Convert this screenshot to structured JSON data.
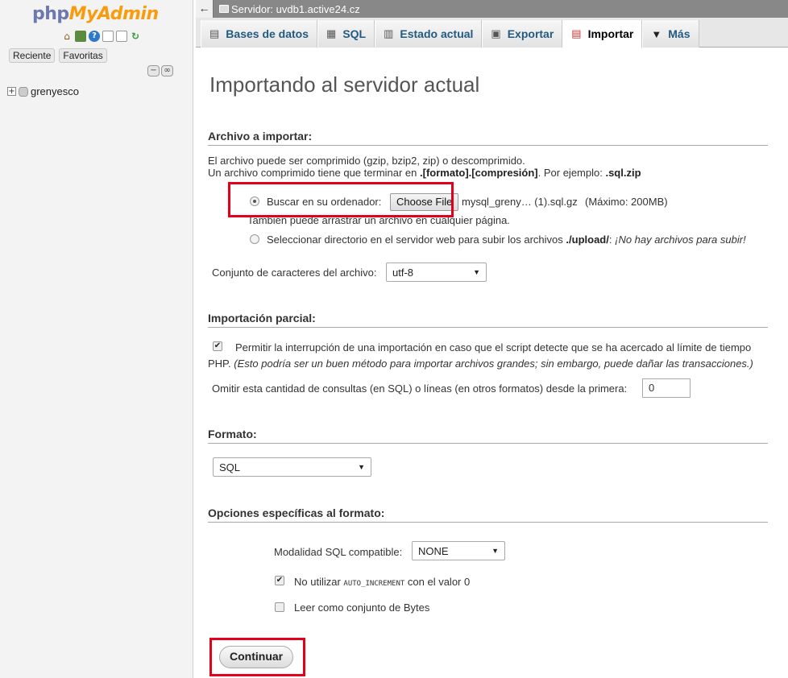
{
  "sidebar": {
    "logo_php": "php",
    "logo_myadmin": "MyAdmin",
    "recent_label": "Reciente",
    "favorites_label": "Favoritas",
    "databases": [
      "grenyesco"
    ]
  },
  "topbar": {
    "breadcrumb": "Servidor: uvdb1.active24.cz"
  },
  "tabs": [
    {
      "label": "Bases de datos",
      "icon": "database-icon"
    },
    {
      "label": "SQL",
      "icon": "sql-icon"
    },
    {
      "label": "Estado actual",
      "icon": "status-icon"
    },
    {
      "label": "Exportar",
      "icon": "export-icon"
    },
    {
      "label": "Importar",
      "icon": "import-icon",
      "active": true
    },
    {
      "label": "Más",
      "icon": "more-icon"
    }
  ],
  "main": {
    "title": "Importando al servidor actual",
    "file_section": {
      "heading": "Archivo a importar:",
      "line1": "El archivo puede ser comprimido (gzip, bzip2, zip) o descomprimido.",
      "line2_pre": "Un archivo comprimido tiene que terminar en ",
      "line2_bold": ".[formato].[compresión]",
      "line2_mid": ". Por ejemplo: ",
      "line2_example": ".sql.zip",
      "browse_label": "Buscar en su ordenador:",
      "choose_file_button": "Choose File",
      "selected_file": "mysql_greny… (1).sql.gz",
      "max_size": "(Máximo: 200MB)",
      "drag_hint": "También puede arrastrar un archivo en cualquier página.",
      "server_dir_label": "Seleccionar directorio en el servidor web para subir los archivos ",
      "server_dir_path": "./upload/",
      "server_dir_colon": ":",
      "no_files": "¡No hay archivos para subir!",
      "charset_label": "Conjunto de caracteres del archivo:",
      "charset_value": "utf-8"
    },
    "partial_section": {
      "heading": "Importación parcial:",
      "allow_interrupt": "Permitir la interrupción de una importación en caso que el script detecte que se ha acercado al límite de tiempo",
      "allow_interrupt_2": "PHP.",
      "allow_interrupt_note": "(Esto podría ser un buen método para importar archivos grandes; sin embargo, puede dañar las transacciones.)",
      "skip_label": "Omitir esta cantidad de consultas (en SQL) o líneas (en otros formatos) desde la primera:",
      "skip_value": "0"
    },
    "format_section": {
      "heading": "Formato:",
      "format_value": "SQL"
    },
    "options_section": {
      "heading": "Opciones específicas al formato:",
      "sql_compat_label": "Modalidad SQL compatible:",
      "sql_compat_value": "NONE",
      "no_auto_pre": "No utilizar ",
      "no_auto_code": "AUTO_INCREMENT",
      "no_auto_post": " con el valor 0",
      "read_bytes": "Leer como conjunto de Bytes"
    },
    "submit_button": "Continuar"
  },
  "highlight_color": "#e2001a"
}
